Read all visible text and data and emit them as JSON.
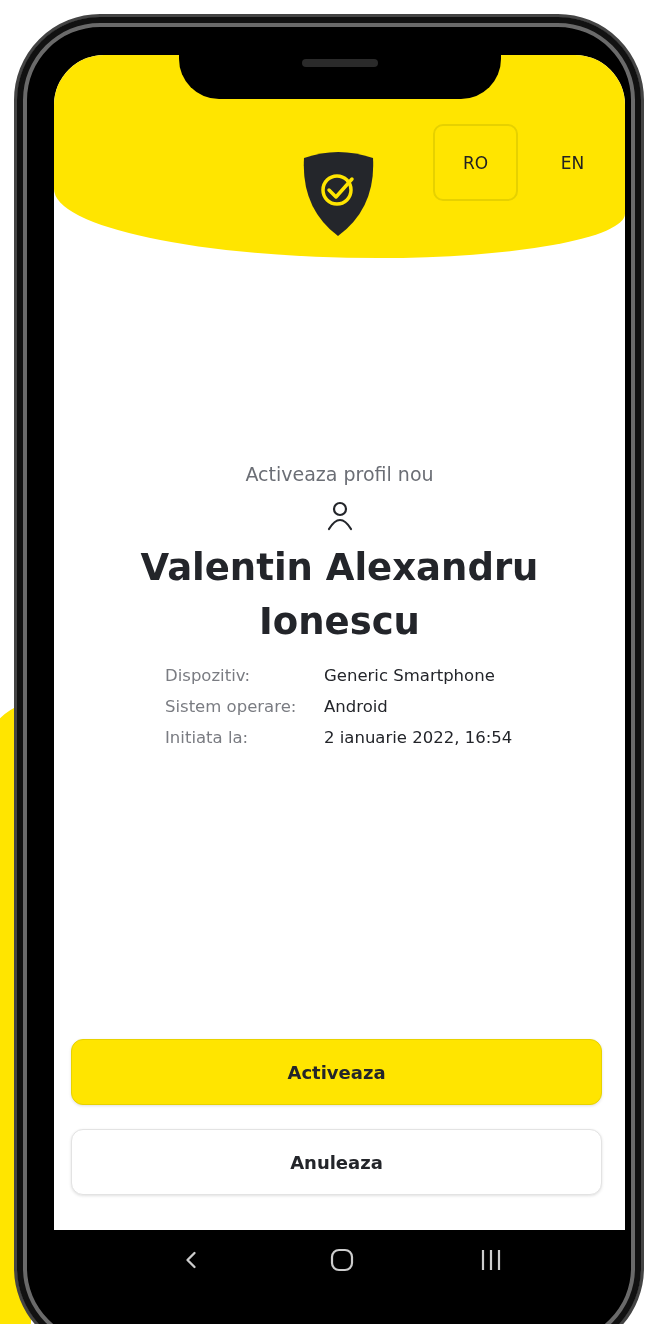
{
  "languages": [
    {
      "label": "RO",
      "selected": true
    },
    {
      "label": "EN",
      "selected": false
    }
  ],
  "title": "Activeaza profil nou",
  "name": "Valentin Alexandru Ionescu",
  "details": [
    {
      "label": "Dispozitiv:",
      "value": "Generic Smartphone"
    },
    {
      "label": "Sistem operare:",
      "value": "Android"
    },
    {
      "label": "Initiata la:",
      "value": "2 ianuarie 2022, 16:54"
    }
  ],
  "buttons": [
    {
      "label": "Activeaza",
      "kind": "primary"
    },
    {
      "label": "Anuleaza",
      "kind": "secondary"
    }
  ]
}
